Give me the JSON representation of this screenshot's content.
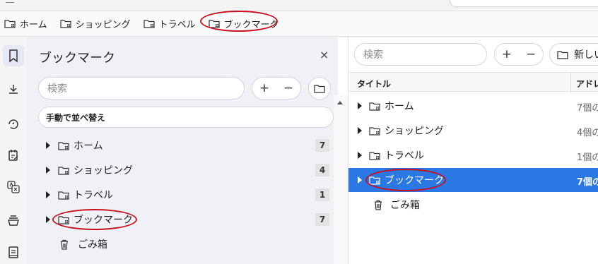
{
  "bookmarks_bar": {
    "items": [
      {
        "label": "ホーム",
        "icon": "folder-icon"
      },
      {
        "label": "ショッピング",
        "icon": "folder-icon"
      },
      {
        "label": "トラベル",
        "icon": "folder-icon"
      },
      {
        "label": "ブックマーク",
        "icon": "folder-icon"
      }
    ]
  },
  "sidebar_rail": {
    "icons": [
      "bookmark-icon",
      "download-icon",
      "history-icon",
      "notes-icon",
      "translate-icon",
      "stack-icon",
      "reading-list-icon"
    ]
  },
  "panel": {
    "title": "ブックマーク",
    "close": "×",
    "search_placeholder": "検索",
    "plus": "+",
    "minus": "−",
    "sort_label": "手動で並べ替え",
    "items": [
      {
        "label": "ホーム",
        "count": "7"
      },
      {
        "label": "ショッピング",
        "count": "4"
      },
      {
        "label": "トラベル",
        "count": "1"
      },
      {
        "label": "ブックマーク",
        "count": "7"
      }
    ],
    "trash_label": "ごみ箱"
  },
  "manager": {
    "search_placeholder": "検索",
    "plus": "+",
    "minus": "−",
    "new_folder_label": "新しい",
    "columns": {
      "title": "タイトル",
      "address": "アドレ"
    },
    "rows": [
      {
        "title": "ホーム",
        "address": "7個の"
      },
      {
        "title": "ショッピング",
        "address": "4個の"
      },
      {
        "title": "トラベル",
        "address": "1個の"
      },
      {
        "title": "ブックマーク",
        "address": "7個の",
        "selected": true
      }
    ],
    "trash_label": "ごみ箱"
  },
  "colors": {
    "accent": "#2a78e3",
    "highlight_oval": "#c8101e",
    "panel_bg": "#f0f1f7"
  }
}
